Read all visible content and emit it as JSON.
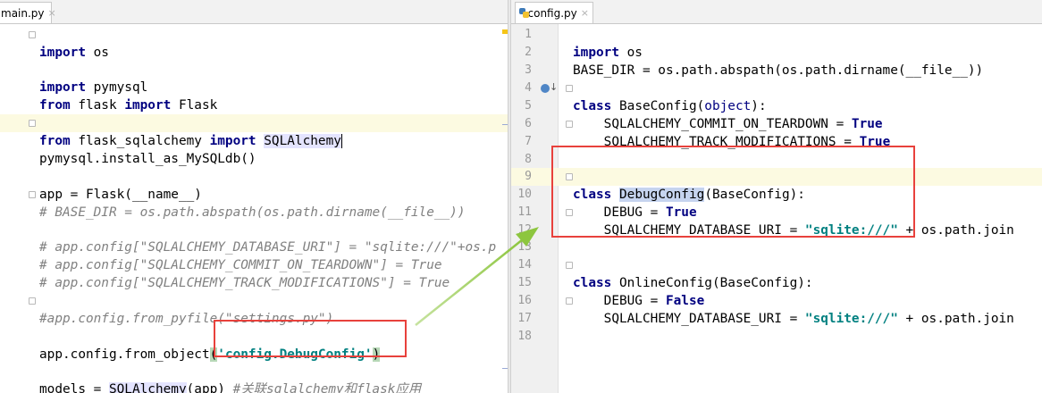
{
  "colors": {
    "keyword": "#000080",
    "comment": "#808080",
    "string": "#008080",
    "highlight_line": "#fcfae1",
    "annotation_red": "#e8413c",
    "arrow_green": "#8dc63f"
  },
  "left_editor": {
    "tab": {
      "label": "main.py",
      "close": "×"
    },
    "lines": {
      "l1": {
        "kw": "import",
        "rest": " os"
      },
      "l3": {
        "kw": "import",
        "rest": " pymysql"
      },
      "l4": {
        "kw1": "from",
        "mid": " flask ",
        "kw2": "import",
        "rest": " Flask"
      },
      "l6": {
        "kw1": "from",
        "mid": " flask_sqlalchemy ",
        "kw2": "import",
        "sp": " ",
        "name": "SQLAlchemy"
      },
      "l7": {
        "text": "pymysql.install_as_MySQLdb()"
      },
      "l9": {
        "text": "app = Flask(__name__)"
      },
      "l10": {
        "text": "# BASE_DIR = os.path.abspath(os.path.dirname(__file__))"
      },
      "l12": {
        "text": "# app.config[\"SQLALCHEMY_DATABASE_URI\"] = \"sqlite:///\"+os.p"
      },
      "l13": {
        "text": "# app.config[\"SQLALCHEMY_COMMIT_ON_TEARDOWN\"] = True"
      },
      "l14": {
        "text": "# app.config[\"SQLALCHEMY_TRACK_MODIFICATIONS\"] = True"
      },
      "l16": {
        "text": "#app.config.from_pyfile(\"settings.py\")"
      },
      "l18": {
        "pre": "app.config.from_object",
        "open": "(",
        "str": "'config.DebugConfig'",
        "close": ")"
      },
      "l20": {
        "pre": "models = ",
        "name": "SQLAlchemy",
        "mid": "(app) ",
        "comment": "#关联sqlalchemy和flask应用"
      }
    }
  },
  "right_editor": {
    "tab": {
      "label": "config.py",
      "close": "×"
    },
    "line_numbers": [
      "1",
      "2",
      "3",
      "4",
      "5",
      "6",
      "7",
      "8",
      "9",
      "10",
      "11",
      "12",
      "13",
      "14",
      "15",
      "16",
      "17",
      "18"
    ],
    "lines": {
      "l1": {
        "kw": "import",
        "rest": " os"
      },
      "l2": {
        "text": "BASE_DIR = os.path.abspath(os.path.dirname(__file__))"
      },
      "l4": {
        "kw": "class",
        "name": " BaseConfig(",
        "builtin": "object",
        "close": "):"
      },
      "l5": {
        "pre": "    SQLALCHEMY_COMMIT_ON_TEARDOWN = ",
        "kw": "True"
      },
      "l6": {
        "pre": "    SQLALCHEMY_TRACK_MODIFICATIONS = ",
        "kw": "True"
      },
      "l9": {
        "kw": "class",
        "sp": " ",
        "name": "DebugConfig",
        "rest": "(BaseConfig):"
      },
      "l10": {
        "pre": "    DEBUG = ",
        "kw": "True"
      },
      "l11": {
        "pre": "    SQLALCHEMY_DATABASE_URI = ",
        "str": "\"sqlite:///\"",
        "rest": " + os.path.join"
      },
      "l14": {
        "kw": "class",
        "rest": " OnlineConfig(BaseConfig):"
      },
      "l15": {
        "pre": "    DEBUG = ",
        "kw": "False"
      },
      "l16": {
        "pre": "    SQLALCHEMY_DATABASE_URI = ",
        "str": "\"sqlite:///\"",
        "rest": " + os.path.join"
      }
    }
  }
}
